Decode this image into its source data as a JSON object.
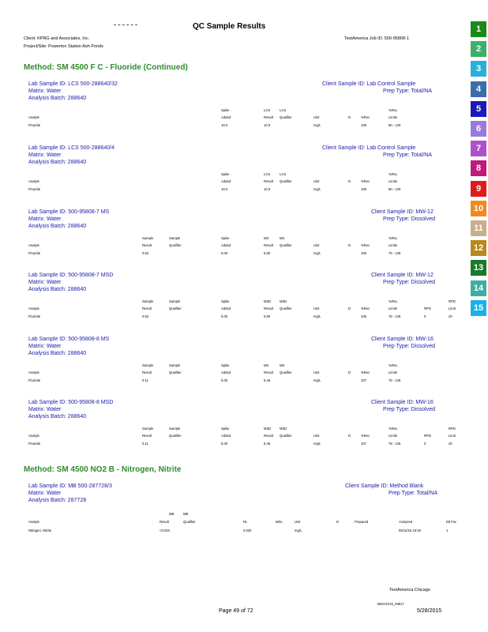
{
  "header": {
    "title": "QC Sample Results",
    "client": "Client: KPRG and Associates, Inc.",
    "project": "Project/Site: Powerton Station Ash Ponds",
    "job": "TestAmerica Job ID: 500-95808-1"
  },
  "tabs": [
    {
      "label": "1",
      "color": "#1a8a1a"
    },
    {
      "label": "2",
      "color": "#3cb06a"
    },
    {
      "label": "3",
      "color": "#2ab0d8"
    },
    {
      "label": "4",
      "color": "#3a6ea8"
    },
    {
      "label": "5",
      "color": "#1a1ab8"
    },
    {
      "label": "6",
      "color": "#9a7ad8"
    },
    {
      "label": "7",
      "color": "#b050c8"
    },
    {
      "label": "8",
      "color": "#c01a7a"
    },
    {
      "label": "9",
      "color": "#e01a1a"
    },
    {
      "label": "10",
      "color": "#f08a1a"
    },
    {
      "label": "11",
      "color": "#c8ae8a"
    },
    {
      "label": "12",
      "color": "#b88a1a"
    },
    {
      "label": "13",
      "color": "#1a7a2a"
    },
    {
      "label": "14",
      "color": "#3cb0a0"
    },
    {
      "label": "15",
      "color": "#1ab0e8"
    }
  ],
  "method1": "Method: SM 4500 F C - Fluoride (Continued)",
  "method2": "Method: SM 4500 NO2 B - Nitrogen, Nitrite",
  "blocks": [
    {
      "id": "Lab Sample ID: LCS 500-288640/32",
      "client": "Client Sample ID: Lab Control Sample",
      "prep": "Prep Type: Total/NA",
      "matrix": "Matrix: Water",
      "batch": "Analysis Batch: 288640",
      "h1": [
        "",
        "",
        "Spike",
        "LCS",
        "LCS",
        "",
        "",
        "",
        "%Rec.",
        "",
        ""
      ],
      "h2": [
        "Analyte",
        "",
        "Added",
        "Result",
        "Qualifier",
        "Unit",
        "D",
        "%Rec",
        "Limits",
        "",
        ""
      ],
      "row": [
        "Fluoride",
        "",
        "10.0",
        "10.9",
        "",
        "mg/L",
        "",
        "109",
        "80 - 120",
        "",
        ""
      ]
    },
    {
      "id": "Lab Sample ID: LCS 500-288640/4",
      "client": "Client Sample ID: Lab Control Sample",
      "prep": "Prep Type: Total/NA",
      "matrix": "Matrix: Water",
      "batch": "Analysis Batch: 288640",
      "h1": [
        "",
        "",
        "Spike",
        "LCS",
        "LCS",
        "",
        "",
        "",
        "%Rec.",
        "",
        ""
      ],
      "h2": [
        "Analyte",
        "",
        "Added",
        "Result",
        "Qualifier",
        "Unit",
        "D",
        "%Rec",
        "Limits",
        "",
        ""
      ],
      "row": [
        "Fluoride",
        "",
        "10.0",
        "10.5",
        "",
        "mg/L",
        "",
        "105",
        "80 - 120",
        "",
        ""
      ]
    },
    {
      "id": "Lab Sample ID: 500-95808-7 MS",
      "client": "Client Sample ID: MW-12",
      "prep": "Prep Type: Dissolved",
      "matrix": "Matrix: Water",
      "batch": "Analysis Batch: 288640",
      "h1": [
        "Sample",
        "Sample",
        "Spike",
        "MS",
        "MS",
        "",
        "",
        "",
        "%Rec.",
        "",
        ""
      ],
      "h2": [
        "Result",
        "Qualifier",
        "Added",
        "Result",
        "Qualifier",
        "Unit",
        "D",
        "%Rec",
        "Limits",
        "",
        ""
      ],
      "row": [
        "0.52",
        "",
        "5.00",
        "5.80",
        "",
        "mg/L",
        "",
        "106",
        "75 - 125",
        "",
        ""
      ]
    },
    {
      "id": "Lab Sample ID: 500-95808-7 MSD",
      "client": "Client Sample ID: MW-12",
      "prep": "Prep Type: Dissolved",
      "matrix": "Matrix: Water",
      "batch": "Analysis Batch: 288640",
      "h1": [
        "Sample",
        "Sample",
        "Spike",
        "MSD",
        "MSD",
        "",
        "",
        "",
        "%Rec.",
        "",
        "RPD"
      ],
      "h2": [
        "Result",
        "Qualifier",
        "Added",
        "Result",
        "Qualifier",
        "Unit",
        "D",
        "%Rec",
        "Limits",
        "RPD",
        "Limit"
      ],
      "row": [
        "0.52",
        "",
        "5.00",
        "5.80",
        "",
        "mg/L",
        "",
        "106",
        "75 - 125",
        "0",
        "20"
      ]
    },
    {
      "id": "Lab Sample ID: 500-95808-8 MS",
      "client": "Client Sample ID: MW-16",
      "prep": "Prep Type: Dissolved",
      "matrix": "Matrix: Water",
      "batch": "Analysis Batch: 288640",
      "h1": [
        "Sample",
        "Sample",
        "Spike",
        "MS",
        "MS",
        "",
        "",
        "",
        "%Rec.",
        "",
        ""
      ],
      "h2": [
        "Result",
        "Qualifier",
        "Added",
        "Result",
        "Qualifier",
        "Unit",
        "D",
        "%Rec",
        "Limits",
        "",
        ""
      ],
      "row": [
        "0.11",
        "",
        "5.00",
        "5.46",
        "",
        "mg/L",
        "",
        "107",
        "75 - 125",
        "",
        ""
      ]
    },
    {
      "id": "Lab Sample ID: 500-95808-8 MSD",
      "client": "Client Sample ID: MW-16",
      "prep": "Prep Type: Dissolved",
      "matrix": "Matrix: Water",
      "batch": "Analysis Batch: 288640",
      "h1": [
        "Sample",
        "Sample",
        "Spike",
        "MSD",
        "MSD",
        "",
        "",
        "",
        "%Rec.",
        "",
        "RPD"
      ],
      "h2": [
        "Result",
        "Qualifier",
        "Added",
        "Result",
        "Qualifier",
        "Unit",
        "D",
        "%Rec",
        "Limits",
        "RPD",
        "Limit"
      ],
      "row": [
        "0.11",
        "",
        "5.00",
        "5.46",
        "",
        "mg/L",
        "",
        "107",
        "75 - 125",
        "0",
        "20"
      ]
    }
  ],
  "analyteLabel": "Analyte",
  "analyteName": "Fluoride",
  "mb": {
    "id": "Lab Sample ID: MB 500-287728/3",
    "client": "Client Sample ID: Method Blank",
    "prep": "Prep Type: Total/NA",
    "matrix": "Matrix: Water",
    "batch": "Analysis Batch: 287728",
    "h1": [
      "MB",
      "MB"
    ],
    "h2": [
      "Analyte",
      "Result",
      "Qualifier",
      "RL",
      "MDL",
      "Unit",
      "D",
      "Prepared",
      "Analyzed",
      "Dil Fac"
    ],
    "row": [
      "Nitrogen, Nitrite",
      "<0.020",
      "",
      "0.020",
      "",
      "mg/L",
      "",
      "",
      "05/12/16 16:30",
      "1"
    ]
  },
  "footer": {
    "lab": "TestAmerica Chicago",
    "page": "Page 49 of 72",
    "code": "MKGIO/15_#8917",
    "date": "5/28/2015"
  }
}
